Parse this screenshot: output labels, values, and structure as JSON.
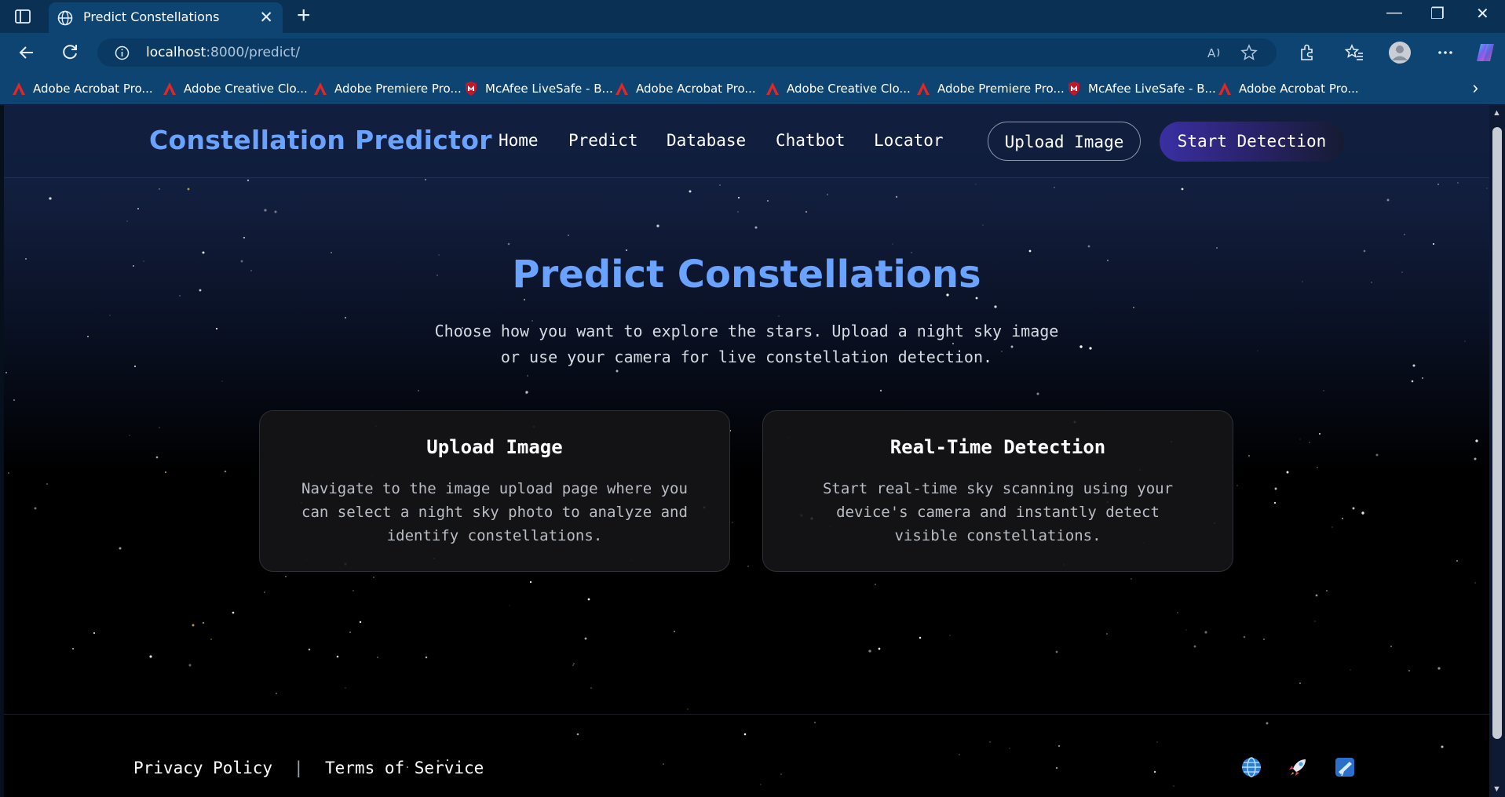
{
  "browser": {
    "tab_title": "Predict Constellations",
    "tab_close": "✕",
    "new_tab": "+",
    "url_host": "localhost",
    "url_path": ":8000/predict/",
    "window_minimize": "—",
    "window_restore": "❐",
    "window_close": "✕",
    "bookmarks": [
      {
        "label": "Adobe Acrobat Pro...",
        "icon": "adobe-icon"
      },
      {
        "label": "Adobe Creative Clo...",
        "icon": "adobe-icon"
      },
      {
        "label": "Adobe Premiere Pro...",
        "icon": "adobe-icon"
      },
      {
        "label": "McAfee LiveSafe - B...",
        "icon": "mcafee-icon"
      },
      {
        "label": "Adobe Acrobat Pro...",
        "icon": "adobe-icon"
      },
      {
        "label": "Adobe Creative Clo...",
        "icon": "adobe-icon"
      },
      {
        "label": "Adobe Premiere Pro...",
        "icon": "adobe-icon"
      },
      {
        "label": "McAfee LiveSafe - B...",
        "icon": "mcafee-icon"
      },
      {
        "label": "Adobe Acrobat Pro...",
        "icon": "adobe-icon"
      }
    ],
    "bookmarks_more": "›"
  },
  "navbar": {
    "brand": "Constellation Predictor",
    "links": [
      "Home",
      "Predict",
      "Database",
      "Chatbot",
      "Locator"
    ],
    "upload_button": "Upload Image",
    "detect_button": "Start Detection"
  },
  "hero": {
    "title": "Predict Constellations",
    "subtitle_line1": "Choose how you want to explore the stars. Upload a night sky image",
    "subtitle_line2": "or use your camera for live constellation detection."
  },
  "cards": [
    {
      "title": "Upload Image",
      "lines": [
        "Navigate to the image upload page where you",
        "can select a night sky photo to analyze and",
        "identify constellations."
      ]
    },
    {
      "title": "Real-Time Detection",
      "lines": [
        "Start real-time sky scanning using your",
        "device's camera and instantly detect",
        "visible constellations."
      ]
    }
  ],
  "footer": {
    "privacy": "Privacy Policy",
    "separator": "|",
    "terms": "Terms of Service",
    "icons": [
      "globe-icon",
      "rocket-icon",
      "telescope-icon"
    ]
  },
  "colors": {
    "brand_accent": "#6aa2ff",
    "browser_chrome": "#0e4471",
    "gradient_button_start": "#3a2fa3"
  }
}
